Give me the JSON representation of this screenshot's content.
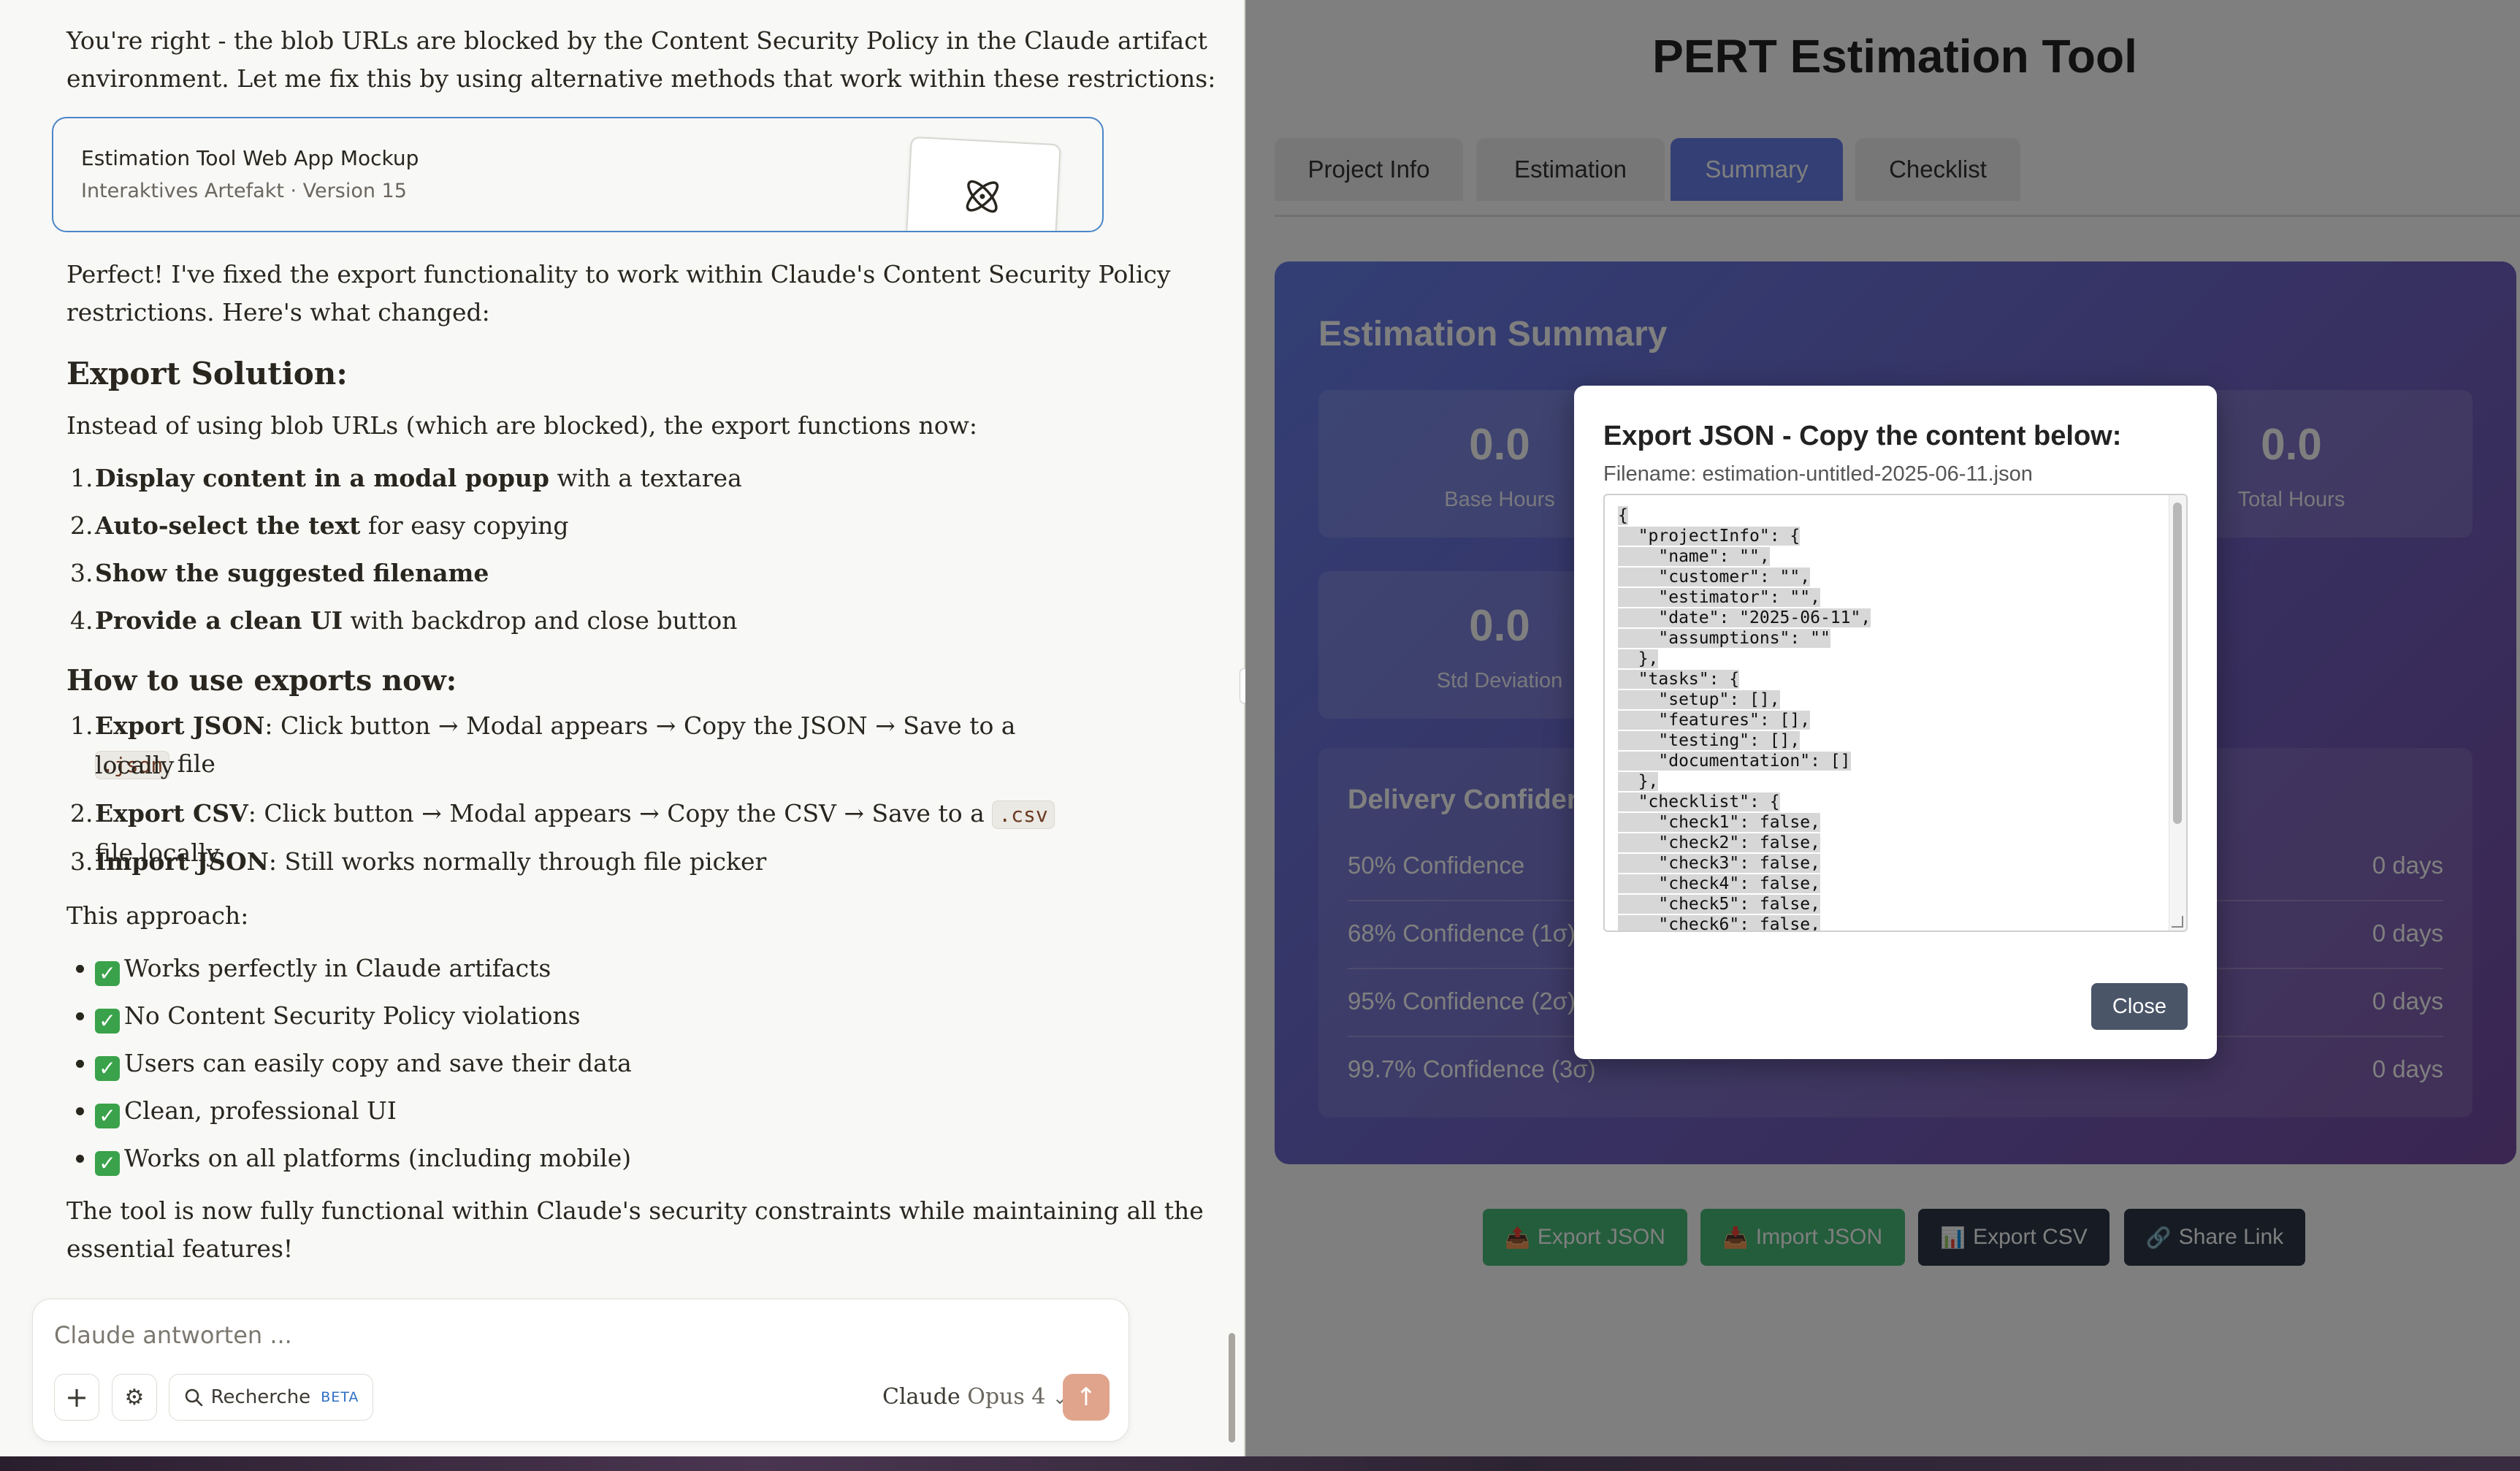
{
  "chat": {
    "intro_line1": "You're right - the blob URLs are blocked by the Content Security Policy in the Claude artifact",
    "intro_line2": "environment. Let me fix this by using alternative methods that work within these restrictions:",
    "artifact": {
      "title": "Estimation Tool Web App Mockup",
      "subtitle": "Interaktives Artefakt · Version 15"
    },
    "perfect_line1": "Perfect! I've fixed the export functionality to work within Claude's Content Security Policy",
    "perfect_line2": "restrictions. Here's what changed:",
    "export_heading": "Export Solution:",
    "export_intro": "Instead of using blob URLs (which are blocked), the export functions now:",
    "export_items": [
      {
        "num": "1.",
        "bold": "Display content in a modal popup",
        "rest": " with a textarea"
      },
      {
        "num": "2.",
        "bold": "Auto-select the text",
        "rest": " for easy copying"
      },
      {
        "num": "3.",
        "bold": "Show the suggested filename",
        "rest": ""
      },
      {
        "num": "4.",
        "bold": "Provide a clean UI",
        "rest": " with backdrop and close button"
      }
    ],
    "howto_heading": "How to use exports now:",
    "howto": {
      "item1_num": "1.",
      "item1_bold": "Export JSON",
      "item1_text": ": Click button → Modal appears → Copy the JSON → Save to a ",
      "item1_code": ".json",
      "item1_end": " file",
      "item1_line2": "locally",
      "item2_num": "2.",
      "item2_bold": "Export CSV",
      "item2_text": ": Click button → Modal appears → Copy the CSV → Save to a ",
      "item2_code": ".csv",
      "item2_end": " file locally",
      "item3_num": "3.",
      "item3_bold": "Import JSON",
      "item3_text": ": Still works normally through file picker"
    },
    "approach_intro": "This approach:",
    "check_glyph": "✓",
    "approach_items": [
      "Works perfectly in Claude artifacts",
      "No Content Security Policy violations",
      "Users can easily copy and save their data",
      "Clean, professional UI",
      "Works on all platforms (including mobile)"
    ],
    "closing_line1": "The tool is now fully functional within Claude's security constraints while maintaining all the",
    "closing_line2": "essential features!",
    "composer": {
      "placeholder": "Claude antworten ...",
      "add_icon": "+",
      "options_icon": "⚙",
      "search_label": "Recherche",
      "search_badge": "BETA",
      "model_name": "Claude",
      "model_version": " Opus 4",
      "model_chevron": "⌄",
      "send_icon": "↑"
    }
  },
  "app": {
    "title": "PERT Estimation Tool",
    "tabs": [
      {
        "label": "Project Info",
        "active": false
      },
      {
        "label": "Estimation",
        "active": false
      },
      {
        "label": "Summary",
        "active": true
      },
      {
        "label": "Checklist",
        "active": false
      }
    ],
    "summary": {
      "title": "Estimation Summary",
      "stats": [
        {
          "value": "0.0",
          "label": "Base Hours"
        },
        {
          "value": "0.0",
          "label": "Total Hours"
        },
        {
          "value": "0.0",
          "label": "Std Deviation"
        }
      ],
      "confidence_title": "Delivery Confidence",
      "confidence_rows": [
        {
          "label": "50% Confidence",
          "value": "0 days"
        },
        {
          "label": "68% Confidence (1σ)",
          "value": "0 days"
        },
        {
          "label": "95% Confidence (2σ)",
          "value": "0 days"
        },
        {
          "label": "99.7% Confidence (3σ)",
          "value": "0 days"
        }
      ]
    },
    "actions": [
      {
        "icon": "📤",
        "label": "Export JSON"
      },
      {
        "icon": "📥",
        "label": "Import JSON"
      },
      {
        "icon": "📊",
        "label": "Export CSV"
      },
      {
        "icon": "🔗",
        "label": "Share Link"
      }
    ]
  },
  "modal": {
    "title": "Export JSON - Copy the content below:",
    "filename_label": "Filename: estimation-untitled-2025-06-11.json",
    "json_lines": [
      "{",
      "  \"projectInfo\": {",
      "    \"name\": \"\",",
      "    \"customer\": \"\",",
      "    \"estimator\": \"\",",
      "    \"date\": \"2025-06-11\",",
      "    \"assumptions\": \"\"",
      "  },",
      "  \"tasks\": {",
      "    \"setup\": [],",
      "    \"features\": [],",
      "    \"testing\": [],",
      "    \"documentation\": []",
      "  },",
      "  \"checklist\": {",
      "    \"check1\": false,",
      "    \"check2\": false,",
      "    \"check3\": false,",
      "    \"check4\": false,",
      "    \"check5\": false,",
      "    \"check6\": false,"
    ],
    "close_label": "Close"
  }
}
